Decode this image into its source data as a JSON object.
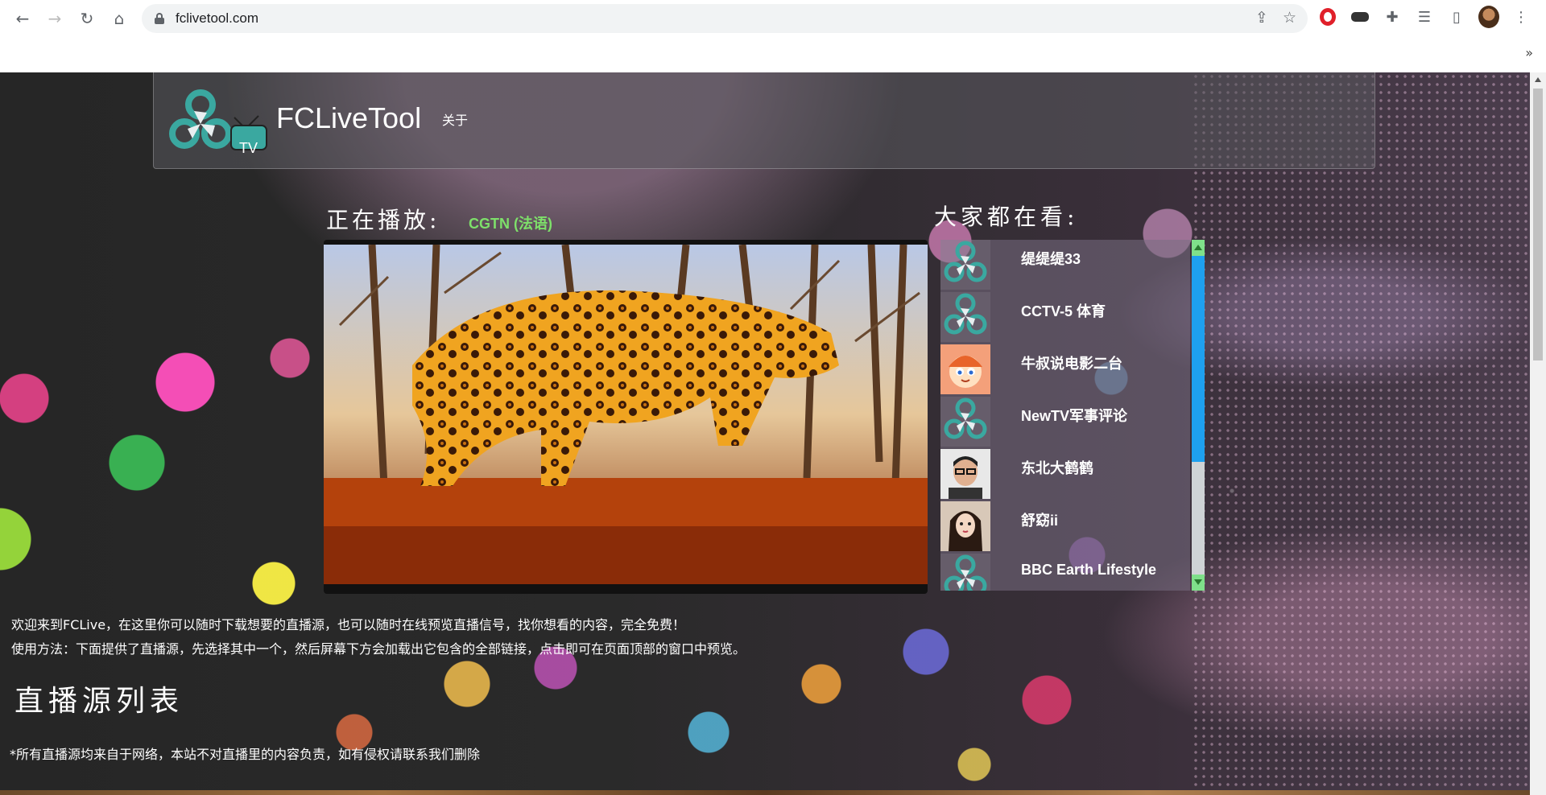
{
  "browser": {
    "url": "fclivetool.com",
    "nav": {
      "back": "←",
      "forward": "→",
      "reload": "↻",
      "home": "⌂"
    },
    "omni_icons": [
      "share-icon",
      "star-icon"
    ],
    "extensions": [
      "opera-icon",
      "mask-icon",
      "puzzle-icon",
      "media-icon",
      "sidepanel-icon"
    ],
    "overflow": "»",
    "menu": "⋮"
  },
  "header": {
    "brand": "FCLiveTool",
    "logo_badge": "TV",
    "about": "关于"
  },
  "player": {
    "label": "正在播放:",
    "channel": "CGTN (法语)"
  },
  "popular": {
    "title": "大家都在看:",
    "items": [
      {
        "name": "缇缇缇33",
        "thumb": "logo"
      },
      {
        "name": "CCTV-5 体育",
        "thumb": "logo"
      },
      {
        "name": "牛叔说电影二台",
        "thumb": "cartoon"
      },
      {
        "name": "NewTV军事评论",
        "thumb": "logo"
      },
      {
        "name": "东北大鹤鹤",
        "thumb": "person"
      },
      {
        "name": "舒窈ii",
        "thumb": "girl"
      },
      {
        "name": "BBC Earth Lifestyle",
        "thumb": "logo"
      }
    ]
  },
  "intro": {
    "line1": "欢迎来到FCLive，在这里你可以随时下载想要的直播源，也可以随时在线预览直播信号，找你想看的内容，完全免费！",
    "line2": "使用方法：下面提供了直播源，先选择其中一个，然后屏幕下方会加载出它包含的全部链接，点击即可在页面顶部的窗口中预览。"
  },
  "section": {
    "title": "直播源列表",
    "disclaimer": "*所有直播源均来自于网络，本站不对直播里的内容负责，如有侵权请联系我们删除"
  },
  "colors": {
    "channel_green": "#7ee06a",
    "logo_teal": "#3aa8a0",
    "scroll_thumb": "#1ea0ef",
    "scroll_btn": "#7fe08a"
  }
}
